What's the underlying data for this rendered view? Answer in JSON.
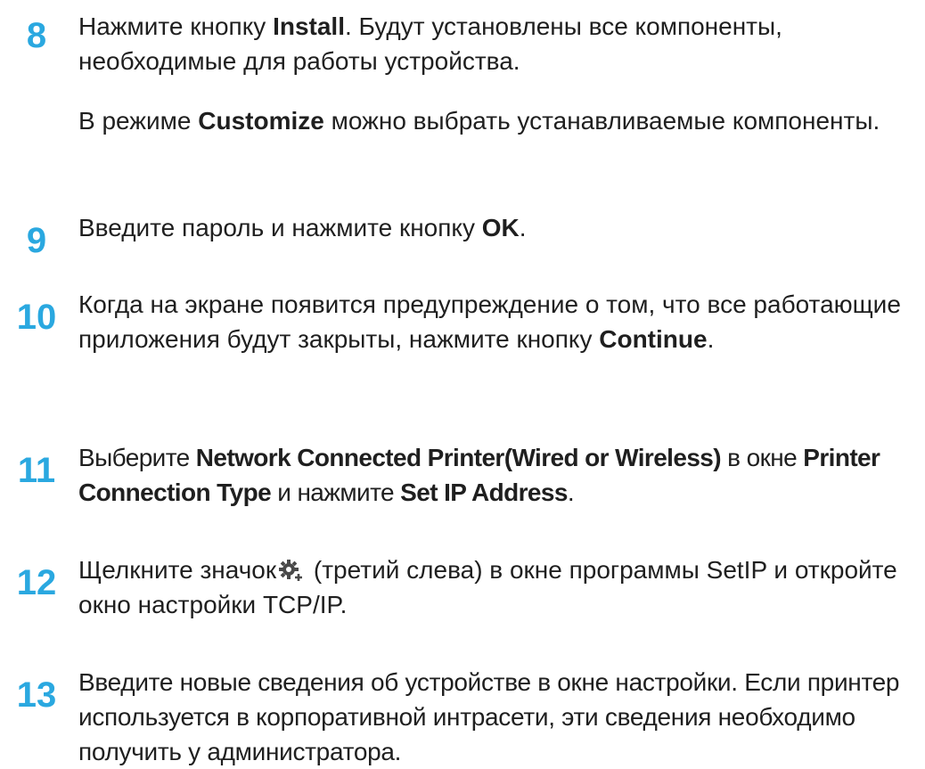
{
  "steps": [
    {
      "number": "8",
      "paragraphs": [
        [
          {
            "t": "Нажмите кнопку "
          },
          {
            "t": "Install",
            "b": true
          },
          {
            "t": ". Будут установлены все компоненты, необходимые для работы устройства."
          }
        ],
        [
          {
            "t": "В режиме "
          },
          {
            "t": "Customize",
            "b": true
          },
          {
            "t": " можно выбрать устанавливаемые компоненты."
          }
        ]
      ]
    },
    {
      "number": "9",
      "paragraphs": [
        [
          {
            "t": "Введите пароль и нажмите кнопку "
          },
          {
            "t": "OK",
            "b": true
          },
          {
            "t": "."
          }
        ]
      ]
    },
    {
      "number": "10",
      "paragraphs": [
        [
          {
            "t": "Когда на экране появится предупреждение о том, что все работающие приложения будут закрыты, нажмите кнопку "
          },
          {
            "t": "Continue",
            "b": true
          },
          {
            "t": "."
          }
        ]
      ]
    },
    {
      "number": "11",
      "paragraphs": [
        [
          {
            "t": "Выберите "
          },
          {
            "t": "Network Connected Printer(Wired or Wireless)",
            "b": true
          },
          {
            "t": " в окне "
          },
          {
            "t": "Printer Connection Type",
            "b": true
          },
          {
            "t": " и нажмите "
          },
          {
            "t": "Set IP Address",
            "b": true
          },
          {
            "t": "."
          }
        ]
      ]
    },
    {
      "number": "12",
      "paragraphs": [
        [
          {
            "t": "Щелкните значок"
          },
          {
            "icon": "gear-plus-icon"
          },
          {
            "t": " (третий слева) в окне программы SetIP и откройте окно настройки TCP/IP."
          }
        ]
      ]
    },
    {
      "number": "13",
      "paragraphs": [
        [
          {
            "t": "Введите новые сведения об устройстве в окне настройки. Если принтер используется в корпоративной интрасети, эти сведения необходимо получить у администратора."
          }
        ]
      ]
    }
  ],
  "colors": {
    "step_number": "#2aa8e0",
    "text": "#1f1f1f",
    "icon": "#4a4a4a"
  }
}
